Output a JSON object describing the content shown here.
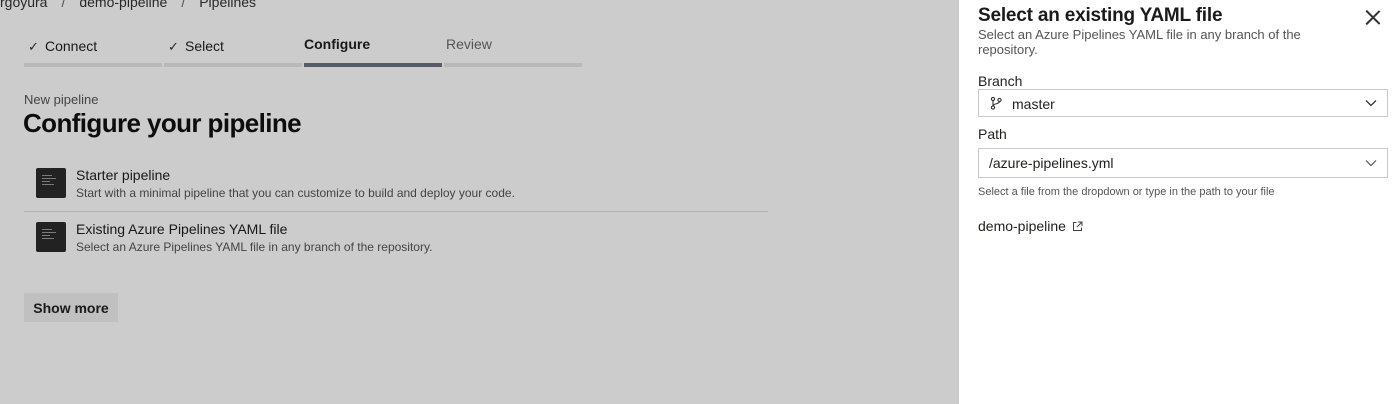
{
  "breadcrumb": {
    "items": [
      "rgoyura",
      "demo-pipeline",
      "Pipelines"
    ]
  },
  "wizard": {
    "steps": [
      {
        "label": "Connect",
        "state": "done"
      },
      {
        "label": "Select",
        "state": "done"
      },
      {
        "label": "Configure",
        "state": "active"
      },
      {
        "label": "Review",
        "state": "future"
      }
    ]
  },
  "page": {
    "subtitle": "New pipeline",
    "title": "Configure your pipeline"
  },
  "options": [
    {
      "name": "Starter pipeline",
      "description": "Start with a minimal pipeline that you can customize to build and deploy your code.",
      "icon": "yaml-file-icon"
    },
    {
      "name": "Existing Azure Pipelines YAML file",
      "description": "Select an Azure Pipelines YAML file in any branch of the repository.",
      "icon": "yaml-file-icon"
    }
  ],
  "show_more_label": "Show more",
  "panel": {
    "title": "Select an existing YAML file",
    "description": "Select an Azure Pipelines YAML file in any branch of the repository.",
    "branch_label": "Branch",
    "branch_value": "master",
    "path_label": "Path",
    "path_value": "/azure-pipelines.yml",
    "path_hint": "Select a file from the dropdown or type in the path to your file",
    "repo_link": "demo-pipeline"
  },
  "colors": {
    "overlay": "rgba(0,0,0,0.2)",
    "active_step_bar": "#6d7480",
    "panel_bg": "#ffffff"
  }
}
